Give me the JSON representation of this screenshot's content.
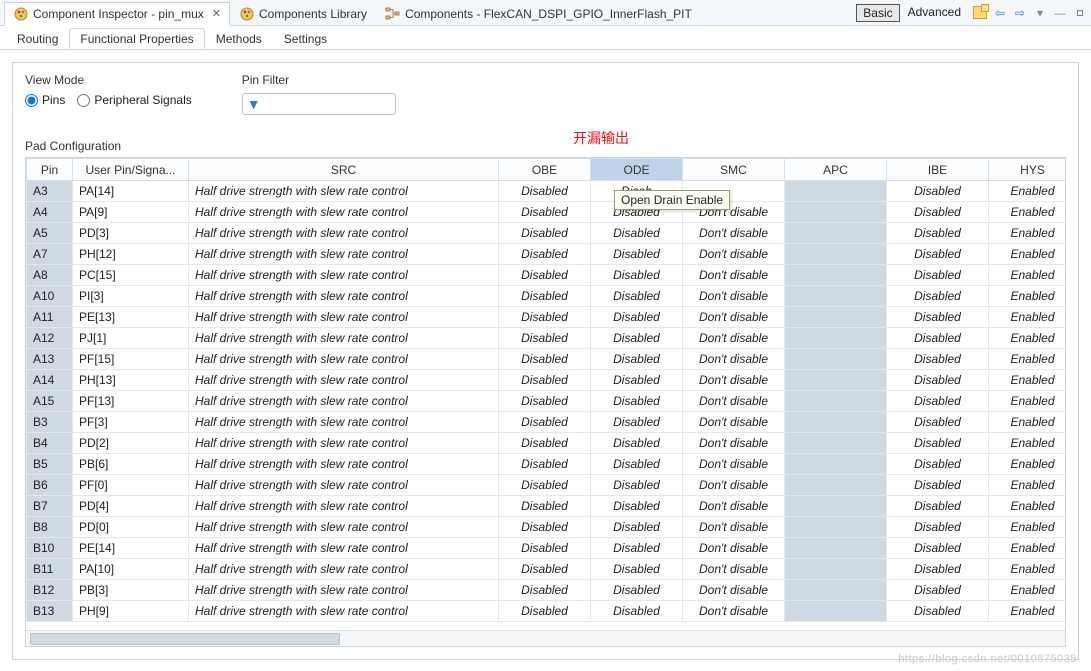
{
  "topTabs": {
    "inspector": "Component Inspector - pin_mux",
    "library": "Components Library",
    "components": "Components - FlexCAN_DSPI_GPIO_InnerFlash_PIT"
  },
  "modes": {
    "basic": "Basic",
    "advanced": "Advanced"
  },
  "subTabs": {
    "routing": "Routing",
    "functional": "Functional Properties",
    "methods": "Methods",
    "settings": "Settings"
  },
  "labels": {
    "viewMode": "View Mode",
    "pins": "Pins",
    "peripheralSignals": "Peripheral Signals",
    "pinFilter": "Pin Filter",
    "padConfig": "Pad Configuration",
    "annotation": "开漏输出",
    "tooltip": "Open Drain Enable"
  },
  "filter": {
    "value": "",
    "placeholder": ""
  },
  "columns": {
    "pin": "Pin",
    "user": "User Pin/Signa...",
    "src": "SRC",
    "obe": "OBE",
    "ode": "ODE",
    "smc": "SMC",
    "apc": "APC",
    "ibe": "IBE",
    "hys": "HYS"
  },
  "rows": [
    {
      "pin": "A3",
      "user": "PA[14]",
      "src": "Half drive strength with slew rate control",
      "obe": "Disabled",
      "ode": "Disab",
      "smc": "",
      "apc": "",
      "ibe": "Disabled",
      "hys": "Enabled"
    },
    {
      "pin": "A4",
      "user": "PA[9]",
      "src": "Half drive strength with slew rate control",
      "obe": "Disabled",
      "ode": "Disabled",
      "smc": "Don't disable",
      "apc": "",
      "ibe": "Disabled",
      "hys": "Enabled"
    },
    {
      "pin": "A5",
      "user": "PD[3]",
      "src": "Half drive strength with slew rate control",
      "obe": "Disabled",
      "ode": "Disabled",
      "smc": "Don't disable",
      "apc": "",
      "ibe": "Disabled",
      "hys": "Enabled"
    },
    {
      "pin": "A7",
      "user": "PH[12]",
      "src": "Half drive strength with slew rate control",
      "obe": "Disabled",
      "ode": "Disabled",
      "smc": "Don't disable",
      "apc": "",
      "ibe": "Disabled",
      "hys": "Enabled"
    },
    {
      "pin": "A8",
      "user": "PC[15]",
      "src": "Half drive strength with slew rate control",
      "obe": "Disabled",
      "ode": "Disabled",
      "smc": "Don't disable",
      "apc": "",
      "ibe": "Disabled",
      "hys": "Enabled"
    },
    {
      "pin": "A10",
      "user": "PI[3]",
      "src": "Half drive strength with slew rate control",
      "obe": "Disabled",
      "ode": "Disabled",
      "smc": "Don't disable",
      "apc": "",
      "ibe": "Disabled",
      "hys": "Enabled"
    },
    {
      "pin": "A11",
      "user": "PE[13]",
      "src": "Half drive strength with slew rate control",
      "obe": "Disabled",
      "ode": "Disabled",
      "smc": "Don't disable",
      "apc": "",
      "ibe": "Disabled",
      "hys": "Enabled"
    },
    {
      "pin": "A12",
      "user": "PJ[1]",
      "src": "Half drive strength with slew rate control",
      "obe": "Disabled",
      "ode": "Disabled",
      "smc": "Don't disable",
      "apc": "",
      "ibe": "Disabled",
      "hys": "Enabled"
    },
    {
      "pin": "A13",
      "user": "PF[15]",
      "src": "Half drive strength with slew rate control",
      "obe": "Disabled",
      "ode": "Disabled",
      "smc": "Don't disable",
      "apc": "",
      "ibe": "Disabled",
      "hys": "Enabled"
    },
    {
      "pin": "A14",
      "user": "PH[13]",
      "src": "Half drive strength with slew rate control",
      "obe": "Disabled",
      "ode": "Disabled",
      "smc": "Don't disable",
      "apc": "",
      "ibe": "Disabled",
      "hys": "Enabled"
    },
    {
      "pin": "A15",
      "user": "PF[13]",
      "src": "Half drive strength with slew rate control",
      "obe": "Disabled",
      "ode": "Disabled",
      "smc": "Don't disable",
      "apc": "",
      "ibe": "Disabled",
      "hys": "Enabled"
    },
    {
      "pin": "B3",
      "user": "PF[3]",
      "src": "Half drive strength with slew rate control",
      "obe": "Disabled",
      "ode": "Disabled",
      "smc": "Don't disable",
      "apc": "",
      "ibe": "Disabled",
      "hys": "Enabled"
    },
    {
      "pin": "B4",
      "user": "PD[2]",
      "src": "Half drive strength with slew rate control",
      "obe": "Disabled",
      "ode": "Disabled",
      "smc": "Don't disable",
      "apc": "",
      "ibe": "Disabled",
      "hys": "Enabled"
    },
    {
      "pin": "B5",
      "user": "PB[6]",
      "src": "Half drive strength with slew rate control",
      "obe": "Disabled",
      "ode": "Disabled",
      "smc": "Don't disable",
      "apc": "",
      "ibe": "Disabled",
      "hys": "Enabled"
    },
    {
      "pin": "B6",
      "user": "PF[0]",
      "src": "Half drive strength with slew rate control",
      "obe": "Disabled",
      "ode": "Disabled",
      "smc": "Don't disable",
      "apc": "",
      "ibe": "Disabled",
      "hys": "Enabled"
    },
    {
      "pin": "B7",
      "user": "PD[4]",
      "src": "Half drive strength with slew rate control",
      "obe": "Disabled",
      "ode": "Disabled",
      "smc": "Don't disable",
      "apc": "",
      "ibe": "Disabled",
      "hys": "Enabled"
    },
    {
      "pin": "B8",
      "user": "PD[0]",
      "src": "Half drive strength with slew rate control",
      "obe": "Disabled",
      "ode": "Disabled",
      "smc": "Don't disable",
      "apc": "",
      "ibe": "Disabled",
      "hys": "Enabled"
    },
    {
      "pin": "B10",
      "user": "PE[14]",
      "src": "Half drive strength with slew rate control",
      "obe": "Disabled",
      "ode": "Disabled",
      "smc": "Don't disable",
      "apc": "",
      "ibe": "Disabled",
      "hys": "Enabled"
    },
    {
      "pin": "B11",
      "user": "PA[10]",
      "src": "Half drive strength with slew rate control",
      "obe": "Disabled",
      "ode": "Disabled",
      "smc": "Don't disable",
      "apc": "",
      "ibe": "Disabled",
      "hys": "Enabled"
    },
    {
      "pin": "B12",
      "user": "PB[3]",
      "src": "Half drive strength with slew rate control",
      "obe": "Disabled",
      "ode": "Disabled",
      "smc": "Don't disable",
      "apc": "",
      "ibe": "Disabled",
      "hys": "Enabled"
    },
    {
      "pin": "B13",
      "user": "PH[9]",
      "src": "Half drive strength with slew rate control",
      "obe": "Disabled",
      "ode": "Disabled",
      "smc": "Don't disable",
      "apc": "",
      "ibe": "Disabled",
      "hys": "Enabled"
    }
  ],
  "watermark": "https://blog.csdn.net/0010875035"
}
